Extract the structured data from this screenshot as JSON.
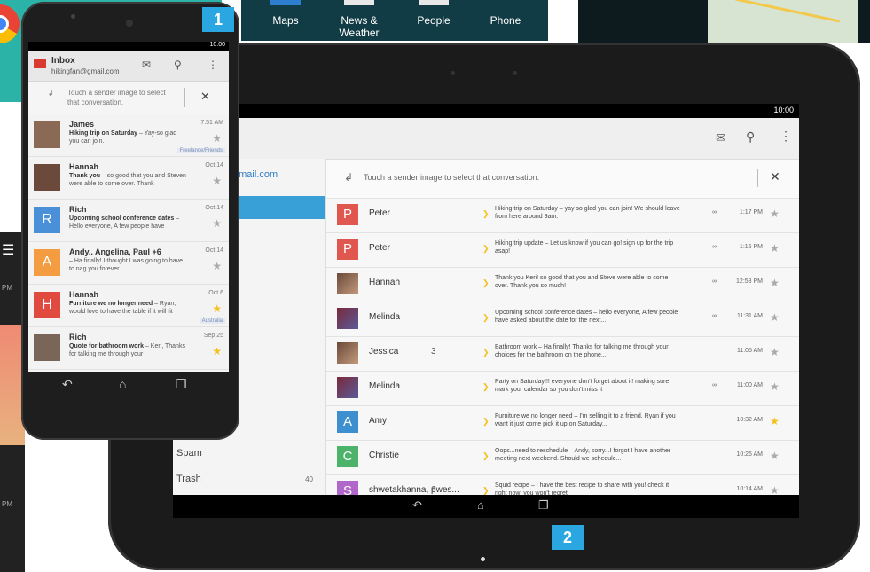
{
  "launcher": {
    "apps": [
      {
        "label": "Maps"
      },
      {
        "label": "News & Weather"
      },
      {
        "label": "People"
      },
      {
        "label": "Phone"
      }
    ]
  },
  "callouts": {
    "phone": "1",
    "tablet": "2"
  },
  "left_fragment": {
    "time1": "PM",
    "time2": "PM"
  },
  "phone": {
    "status_time": "10:00",
    "title": "Inbox",
    "account": "hikingfan@gmail.com",
    "hint": "Touch a sender image to select that conversation.",
    "emails": [
      {
        "sender": "James",
        "subject": "Hiking trip on Saturday",
        "snippet": " – Yay-so glad you can join.",
        "time": "7:51 AM",
        "label": "Freelance/Friends",
        "avatar": "",
        "avatar_color": "#8a6a55",
        "starred": false
      },
      {
        "sender": "Hannah",
        "subject": "Thank you",
        "snippet": " – so good that you and Steven were able to come over. Thank",
        "time": "Oct 14",
        "label": "",
        "avatar": "",
        "avatar_color": "#6b4a3c",
        "starred": false
      },
      {
        "sender": "Rich",
        "subject": "Upcoming school conference dates",
        "snippet": " – Hello everyone, A few people have",
        "time": "Oct 14",
        "label": "",
        "avatar": "R",
        "avatar_color": "#4a90d9",
        "starred": false
      },
      {
        "sender": "Andy.. Angelina, Paul +6",
        "subject": "",
        "snippet": "– Ha finally! I thought I was going to have to nag you forever.",
        "time": "Oct 14",
        "label": "",
        "avatar": "A",
        "avatar_color": "#f39c42",
        "starred": false
      },
      {
        "sender": "Hannah",
        "subject": "Furniture we no longer need",
        "snippet": " – Ryan, would love to have the table if it will fit",
        "time": "Oct 6",
        "label": "Australia",
        "avatar": "H",
        "avatar_color": "#e04a3f",
        "starred": true
      },
      {
        "sender": "Rich",
        "subject": "Quote for bathroom work",
        "snippet": " – Keri, Thanks for talking me through your",
        "time": "Sep 25",
        "label": "",
        "avatar": "",
        "avatar_color": "#7a6658",
        "starred": true
      }
    ]
  },
  "tablet": {
    "status_time": "10:00",
    "account_fragment": "gmail.com",
    "hint": "Touch a sender image to select that conversation.",
    "folders": [
      {
        "name": "Spam",
        "count": ""
      },
      {
        "name": "Trash",
        "count": "40"
      }
    ],
    "emails": [
      {
        "sender": "Peter",
        "count": "",
        "avatar": "P",
        "avatar_color": "#e0574f",
        "snippet": "Hiking trip on Saturday – yay so glad you can join! We should leave from here around 9am.",
        "time": "1:17 PM",
        "clip": true,
        "starred": false
      },
      {
        "sender": "Peter",
        "count": "",
        "avatar": "P",
        "avatar_color": "#e0574f",
        "snippet": "Hiking trip update – Let us know if you can go! sign up for the trip asap!",
        "time": "1:15 PM",
        "clip": true,
        "starred": false
      },
      {
        "sender": "Hannah",
        "count": "",
        "avatar": "",
        "avatar_color": "photo",
        "snippet": "Thank you Keri! so good that you and Steve were able to come over. Thank you so much!",
        "time": "12:58 PM",
        "clip": true,
        "starred": false
      },
      {
        "sender": "Melinda",
        "count": "",
        "avatar": "",
        "avatar_color": "photo2",
        "snippet": "Upcoming school conference dates – hello everyone, A few people have asked about the date for the next...",
        "time": "11:31 AM",
        "clip": true,
        "starred": false
      },
      {
        "sender": "Jessica",
        "count": "3",
        "avatar": "",
        "avatar_color": "photo",
        "snippet": "Bathroom work – Ha finally! Thanks for talking me through your choices for the bathroom on the phone...",
        "time": "11:05 AM",
        "clip": false,
        "starred": false
      },
      {
        "sender": "Melinda",
        "count": "",
        "avatar": "",
        "avatar_color": "photo2",
        "snippet": "Party on Saturday!!! everyone don't forget about it! making sure mark your calendar so you don't miss it",
        "time": "11:00 AM",
        "clip": true,
        "starred": false
      },
      {
        "sender": "Amy",
        "count": "",
        "avatar": "A",
        "avatar_color": "#3d8fd0",
        "snippet": "Furniture we no longer need – I'm selling it to a friend. Ryan if you want it just come pick it up on Saturday...",
        "time": "10:32 AM",
        "clip": false,
        "starred": true
      },
      {
        "sender": "Christie",
        "count": "",
        "avatar": "C",
        "avatar_color": "#4db36a",
        "snippet": "Oops...need to reschedule – Andy, sorry...I forgot I have another meeting next weekend. Should we schedule...",
        "time": "10:26 AM",
        "clip": false,
        "starred": false
      },
      {
        "sender": "shwetakhanna, pwes...",
        "count": "6",
        "avatar": "S",
        "avatar_color": "#b067c9",
        "snippet": "Squid recipe – I have the best recipe to share with you! check it right now! you won't regret",
        "time": "10:14 AM",
        "clip": false,
        "starred": false
      }
    ]
  }
}
